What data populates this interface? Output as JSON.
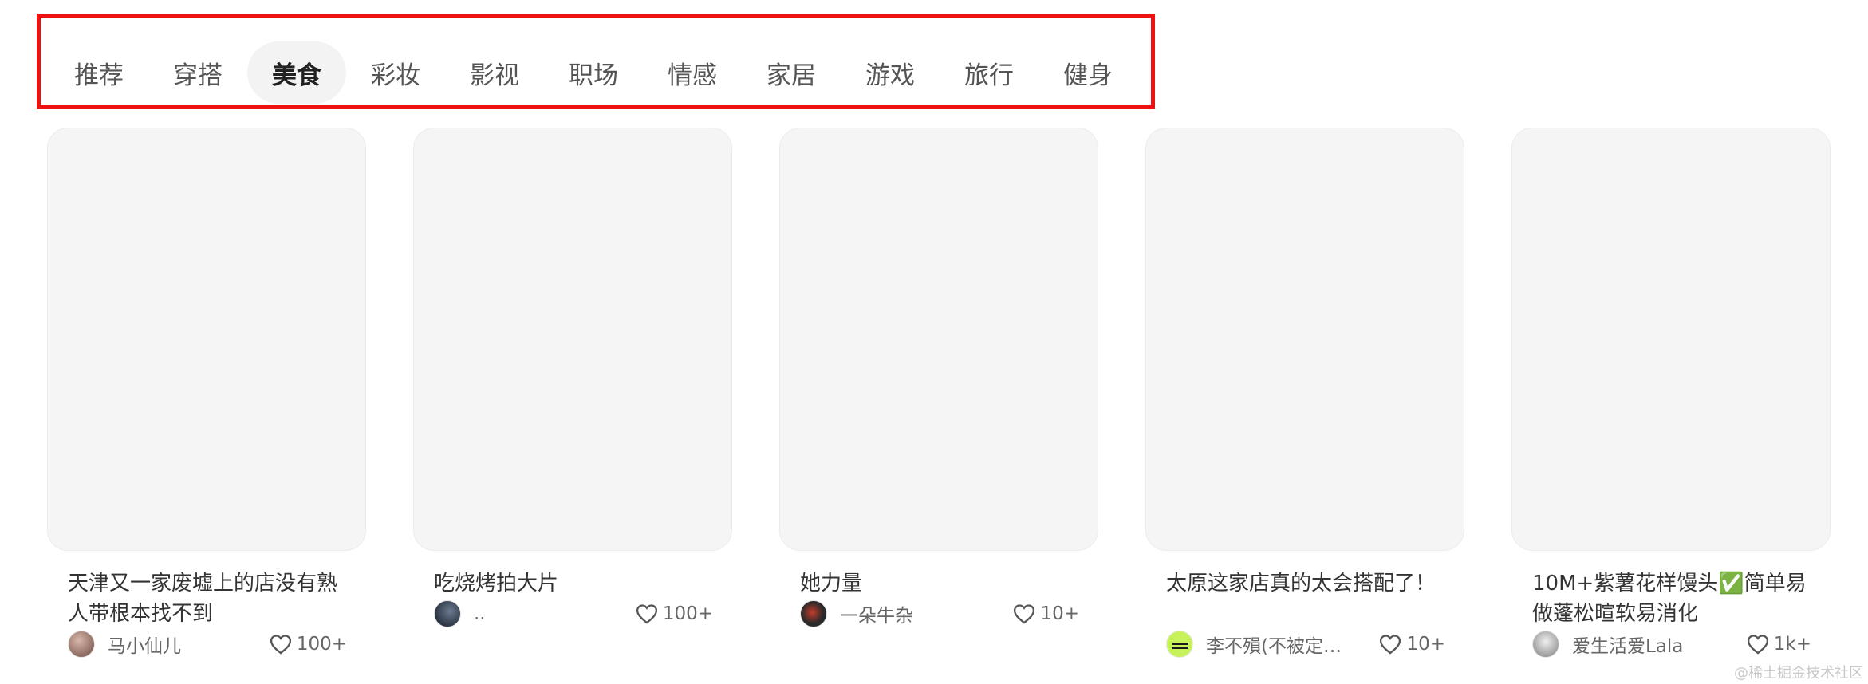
{
  "tabs": [
    {
      "label": "推荐",
      "active": false
    },
    {
      "label": "穿搭",
      "active": false
    },
    {
      "label": "美食",
      "active": true
    },
    {
      "label": "彩妆",
      "active": false
    },
    {
      "label": "影视",
      "active": false
    },
    {
      "label": "职场",
      "active": false
    },
    {
      "label": "情感",
      "active": false
    },
    {
      "label": "家居",
      "active": false
    },
    {
      "label": "游戏",
      "active": false
    },
    {
      "label": "旅行",
      "active": false
    },
    {
      "label": "健身",
      "active": false
    }
  ],
  "notes": [
    {
      "title": "天津又一家废墟上的店没有熟人带根本找不到",
      "author": "马小仙儿",
      "likes": "100+"
    },
    {
      "title": "吃烧烤拍大片",
      "author": "..",
      "likes": "100+"
    },
    {
      "title": "她力量",
      "author": "一朵牛杂",
      "likes": "10+"
    },
    {
      "title": "太原这家店真的太会搭配了！",
      "author": "李不殞(不被定义 ...",
      "likes": "10+"
    },
    {
      "title": "10M+紫薯花样馒头✅简单易做蓬松暄软易消化",
      "author": "爱生活爱Lala",
      "likes": "1k+"
    }
  ],
  "icons": {
    "like": "heart-outline-icon"
  },
  "colors": {
    "highlight_border": "#ee1111",
    "active_tab_bg": "#f3f3f3"
  },
  "watermark": "@稀土掘金技术社区"
}
